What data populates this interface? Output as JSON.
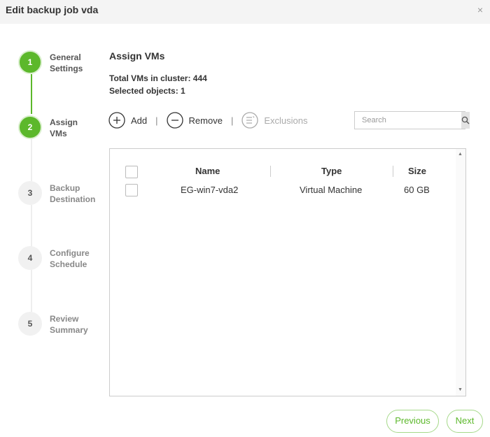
{
  "dialog": {
    "title": "Edit backup job vda",
    "close_glyph": "×"
  },
  "steps": [
    {
      "num": "1",
      "label": "General\nSettings",
      "state": "done"
    },
    {
      "num": "2",
      "label": "Assign\nVMs",
      "state": "active"
    },
    {
      "num": "3",
      "label": "Backup\nDestination",
      "state": "pending"
    },
    {
      "num": "4",
      "label": "Configure\nSchedule",
      "state": "pending"
    },
    {
      "num": "5",
      "label": "Review\nSummary",
      "state": "pending"
    }
  ],
  "main": {
    "heading": "Assign VMs",
    "total_vms": "Total VMs in cluster: 444",
    "selected_objects": "Selected objects: 1"
  },
  "toolbar": {
    "add_label": "Add",
    "remove_label": "Remove",
    "exclusions_label": "Exclusions",
    "separator": "|",
    "search_placeholder": "Search"
  },
  "table": {
    "columns": [
      "Name",
      "Type",
      "Size"
    ],
    "rows": [
      {
        "name": "EG-win7-vda2",
        "type": "Virtual Machine",
        "size": "60 GB",
        "checked": false
      }
    ]
  },
  "buttons": {
    "previous": "Previous",
    "next": "Next"
  },
  "colors": {
    "accent": "#5cb82b",
    "accent_light": "#a6d98a"
  },
  "icons": [
    "plus-circle-icon",
    "minus-circle-icon",
    "list-icon",
    "search-icon",
    "close-icon"
  ]
}
